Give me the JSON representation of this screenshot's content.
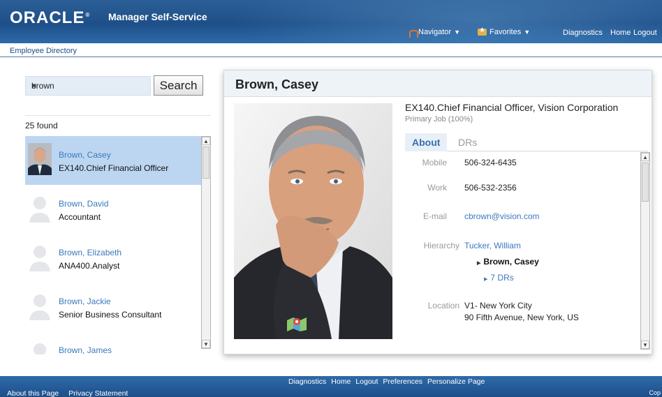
{
  "header": {
    "logo": "ORACLE",
    "logo_mark": "®",
    "app_title": "Manager Self-Service",
    "navigator_label": "Navigator",
    "favorites_label": "Favorites",
    "links": [
      "Diagnostics",
      "Home",
      "Logout"
    ]
  },
  "breadcrumb": "Employee Directory",
  "search": {
    "value": "brown",
    "clear": "×",
    "button_label": "Search"
  },
  "results_count": "25 found",
  "results": [
    {
      "name": "Brown, Casey",
      "job": "EX140.Chief Financial Officer",
      "selected": true
    },
    {
      "name": "Brown, David",
      "job": "Accountant",
      "selected": false
    },
    {
      "name": "Brown, Elizabeth",
      "job": "ANA400.Analyst",
      "selected": false
    },
    {
      "name": "Brown, Jackie",
      "job": "Senior Business Consultant",
      "selected": false
    },
    {
      "name": "Brown, James",
      "job": "",
      "selected": false
    }
  ],
  "profile": {
    "name": "Brown, Casey",
    "job_title": "EX140.Chief Financial Officer, Vision Corporation",
    "job_sub": "Primary Job (100%)",
    "tabs": [
      "About",
      "DRs"
    ],
    "mobile_label": "Mobile",
    "mobile": "506-324-6435",
    "work_label": "Work",
    "work": "506-532-2356",
    "email_label": "E-mail",
    "email": "cbrown@vision.com",
    "hierarchy_label": "Hierarchy",
    "manager": "Tucker, William",
    "self": "Brown, Casey",
    "drs": "7 DRs",
    "location_label": "Location",
    "location_line1": "V1- New York City",
    "location_line2": "90 Fifth Avenue, New York, US"
  },
  "footer": {
    "links": [
      "Diagnostics",
      "Home",
      "Logout",
      "Preferences",
      "Personalize Page"
    ],
    "left_links": [
      "About this Page",
      "Privacy Statement"
    ],
    "copyright": "Cop"
  },
  "colors": {
    "header_blue": "#1e4f88",
    "link_blue": "#3a78be",
    "selected_row": "#bcd6f2"
  }
}
